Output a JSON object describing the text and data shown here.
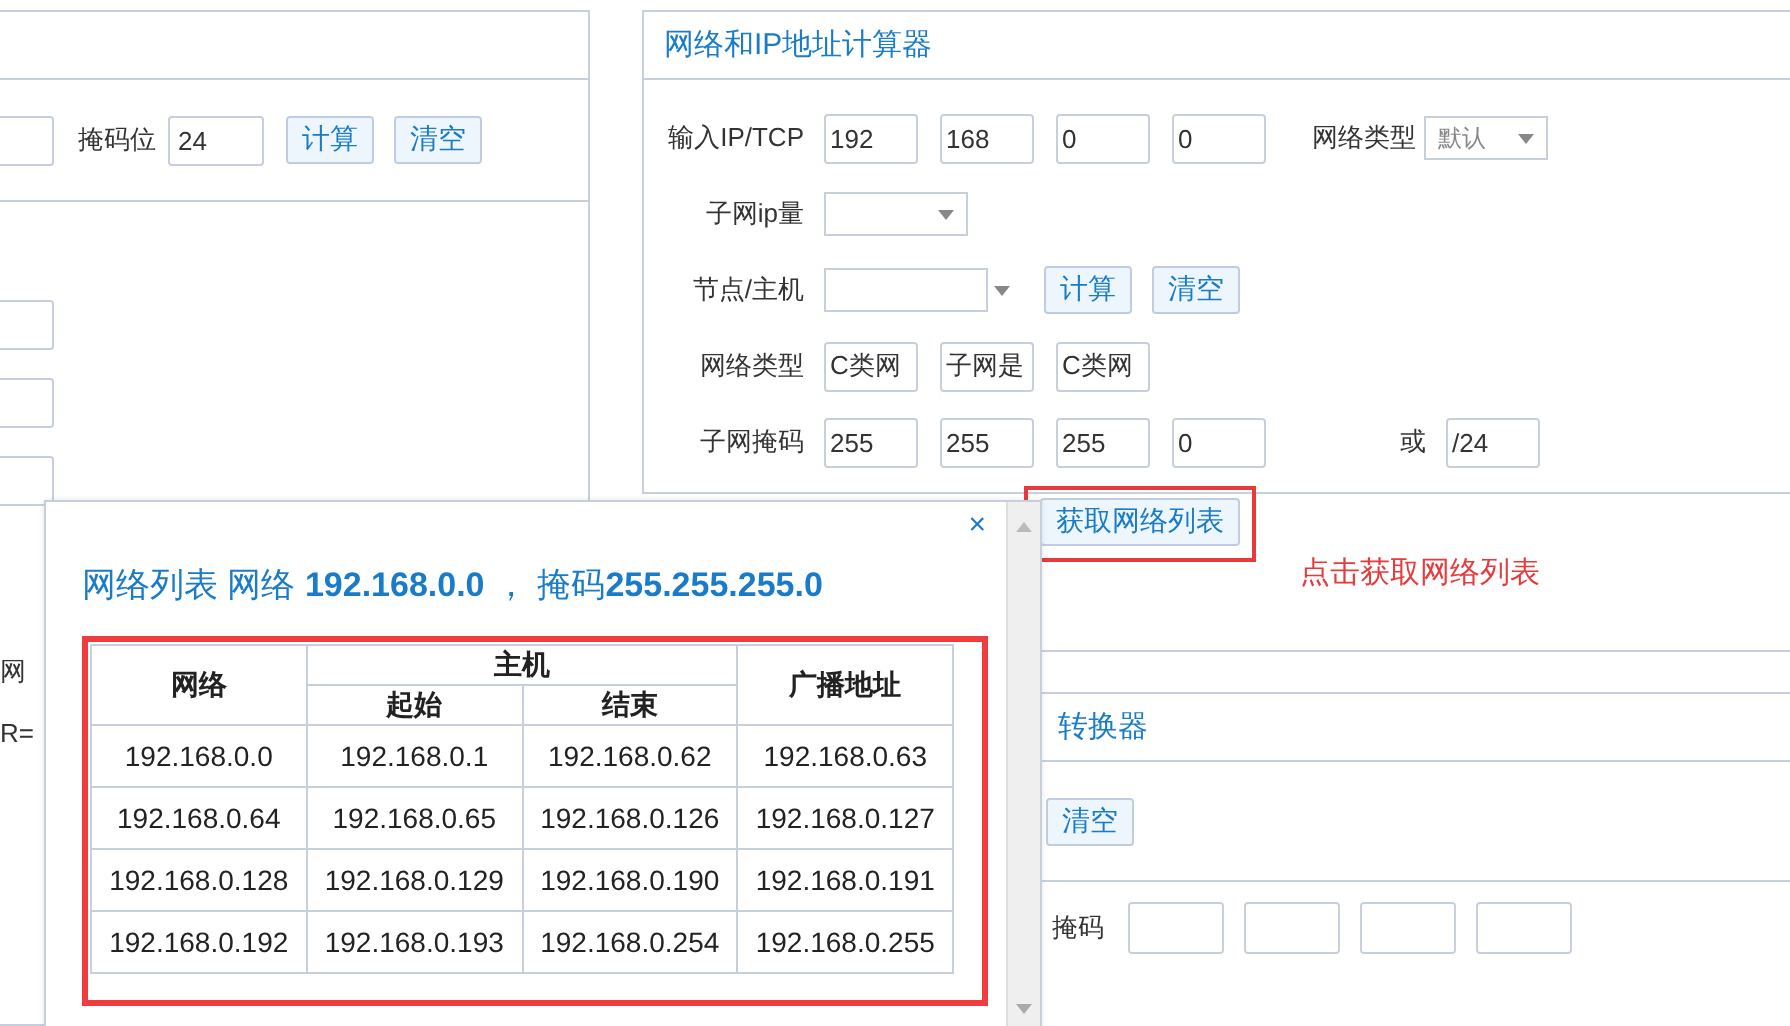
{
  "left_panel": {
    "mask_label": "掩码位",
    "mask_value": "24",
    "buttons": [
      "计算",
      "清空"
    ],
    "fragments": [
      "网",
      "R="
    ]
  },
  "calculator": {
    "title": "网络和IP地址计算器",
    "rows": [
      {
        "kind": "octets",
        "label": "输入IP/TCP",
        "values": [
          "192",
          "168",
          "0",
          "0"
        ],
        "type_label": "网络类型",
        "type_select": "默认"
      },
      {
        "kind": "select",
        "label": "子网ip量"
      },
      {
        "kind": "combo",
        "label": "节点/主机",
        "buttons": [
          "计算",
          "清空"
        ]
      },
      {
        "kind": "boxes",
        "label": "网络类型",
        "values": [
          "C类网",
          "子网是",
          "C类网"
        ]
      },
      {
        "kind": "octets",
        "label": "子网掩码",
        "values": [
          "255",
          "255",
          "255",
          "0"
        ],
        "or_label": "或",
        "prefix": "/24"
      }
    ]
  },
  "list_button": "获取网络列表",
  "hint": "点击获取网络列表",
  "converter": {
    "title": "转换器",
    "button": "清空",
    "mask_label": "掩码"
  },
  "dialog": {
    "title": "网络列表  网络 **192.168.0.0** ， 掩码**255.255.255.0**",
    "close": "×",
    "columns": {
      "network": "网络",
      "host": "主机",
      "start": "起始",
      "end": "结束",
      "broadcast": "广播地址"
    },
    "rows": [
      [
        "192.168.0.0",
        "192.168.0.1",
        "192.168.0.62",
        "192.168.0.63"
      ],
      [
        "192.168.0.64",
        "192.168.0.65",
        "192.168.0.126",
        "192.168.0.127"
      ],
      [
        "192.168.0.128",
        "192.168.0.129",
        "192.168.0.190",
        "192.168.0.191"
      ],
      [
        "192.168.0.192",
        "192.168.0.193",
        "192.168.0.254",
        "192.168.0.255"
      ]
    ]
  }
}
